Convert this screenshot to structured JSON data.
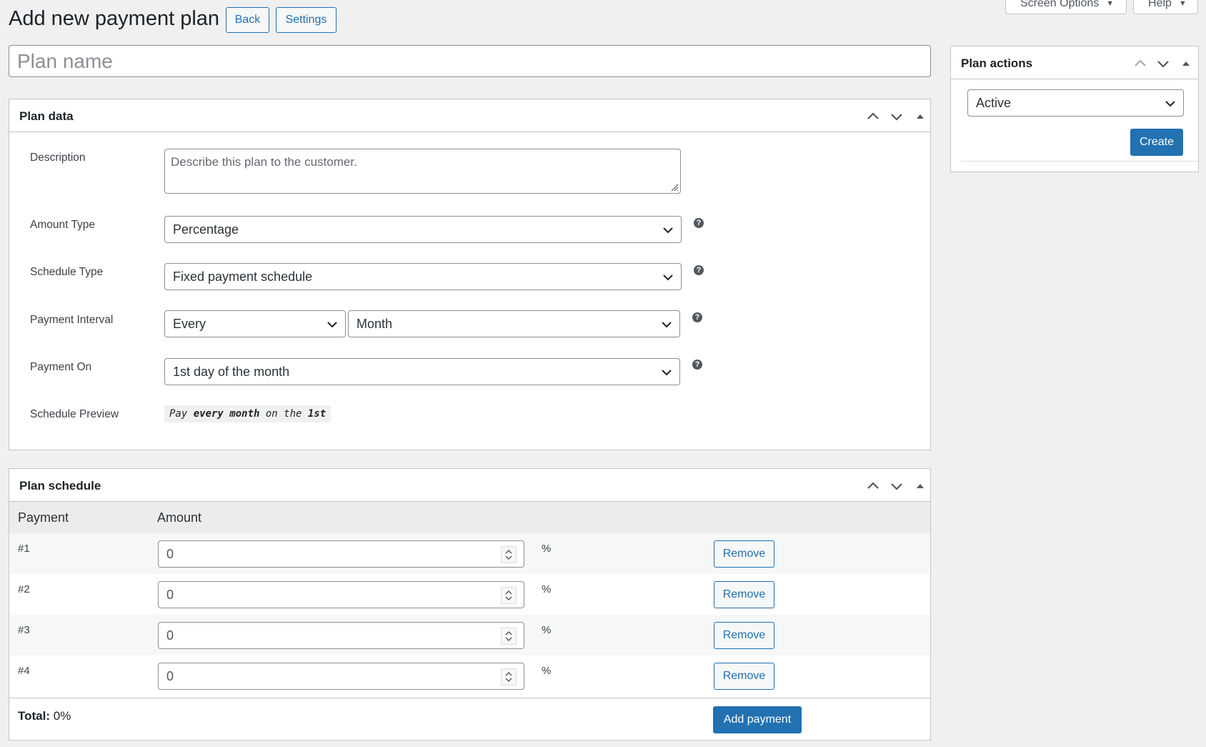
{
  "top_tabs": {
    "screen_options": "Screen Options",
    "help": "Help"
  },
  "page": {
    "title": "Add new payment plan",
    "back_label": "Back",
    "settings_label": "Settings",
    "plan_name_placeholder": "Plan name"
  },
  "plan_data": {
    "title": "Plan data",
    "fields": {
      "description": {
        "label": "Description",
        "placeholder": "Describe this plan to the customer."
      },
      "amount_type": {
        "label": "Amount Type",
        "value": "Percentage"
      },
      "schedule_type": {
        "label": "Schedule Type",
        "value": "Fixed payment schedule"
      },
      "payment_interval": {
        "label": "Payment Interval",
        "every": "Every",
        "unit": "Month"
      },
      "payment_on": {
        "label": "Payment On",
        "value": "1st day of the month"
      },
      "schedule_preview": {
        "label": "Schedule Preview",
        "p1": "Pay ",
        "b1": "every month",
        "p2": " on the ",
        "b2": "1st"
      }
    },
    "help_glyph": "?"
  },
  "plan_schedule": {
    "title": "Plan schedule",
    "columns": {
      "payment": "Payment",
      "amount": "Amount"
    },
    "rows": [
      {
        "payment": "#1",
        "amount": "0",
        "unit": "%",
        "remove": "Remove"
      },
      {
        "payment": "#2",
        "amount": "0",
        "unit": "%",
        "remove": "Remove"
      },
      {
        "payment": "#3",
        "amount": "0",
        "unit": "%",
        "remove": "Remove"
      },
      {
        "payment": "#4",
        "amount": "0",
        "unit": "%",
        "remove": "Remove"
      }
    ],
    "total_label": "Total:",
    "total_value": " 0%",
    "add_payment": "Add payment"
  },
  "plan_actions": {
    "title": "Plan actions",
    "status": "Active",
    "create": "Create"
  },
  "colors": {
    "accent": "#2271b1",
    "background": "#f0f0f1"
  }
}
